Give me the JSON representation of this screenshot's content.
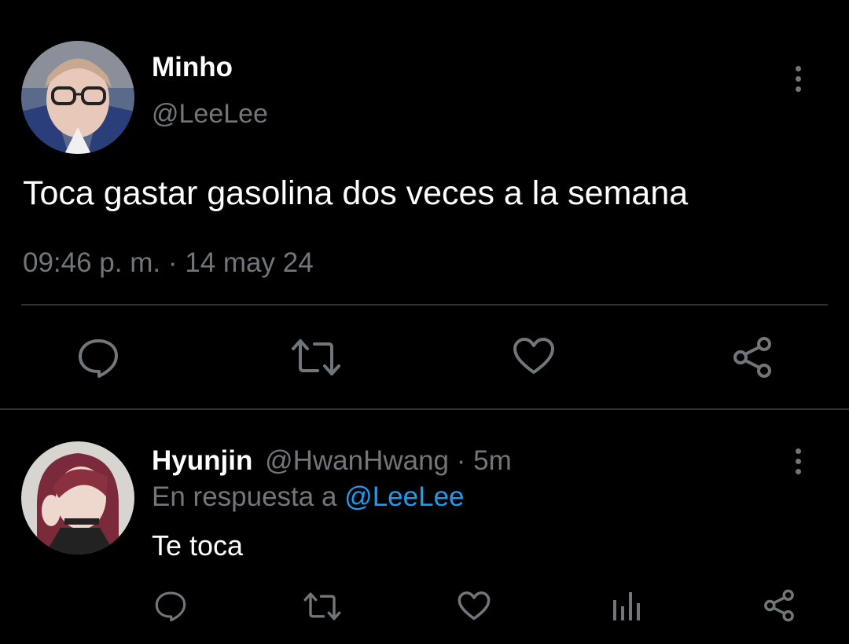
{
  "tweet": {
    "author_name": "Minho",
    "author_handle": "@LeeLee",
    "text": "Toca gastar gasolina dos veces a la semana",
    "time": "09:46 p. m.",
    "separator": "·",
    "date": "14 may 24",
    "more_icon": "more-vertical-icon",
    "actions": [
      "reply-icon",
      "retweet-icon",
      "like-icon",
      "share-icon"
    ]
  },
  "reply": {
    "author_name": "Hyunjin",
    "author_handle": "@HwanHwang",
    "separator": "·",
    "age": "5m",
    "in_reply_prefix": "En respuesta a",
    "in_reply_handle": "@LeeLee",
    "text": "Te toca",
    "more_icon": "more-vertical-icon",
    "actions": [
      "reply-icon",
      "retweet-icon",
      "like-icon",
      "analytics-icon",
      "share-icon"
    ]
  },
  "colors": {
    "background": "#000000",
    "text": "#e7e9ea",
    "muted": "#71767b",
    "link": "#1d9bf0",
    "divider": "#2f3336"
  }
}
